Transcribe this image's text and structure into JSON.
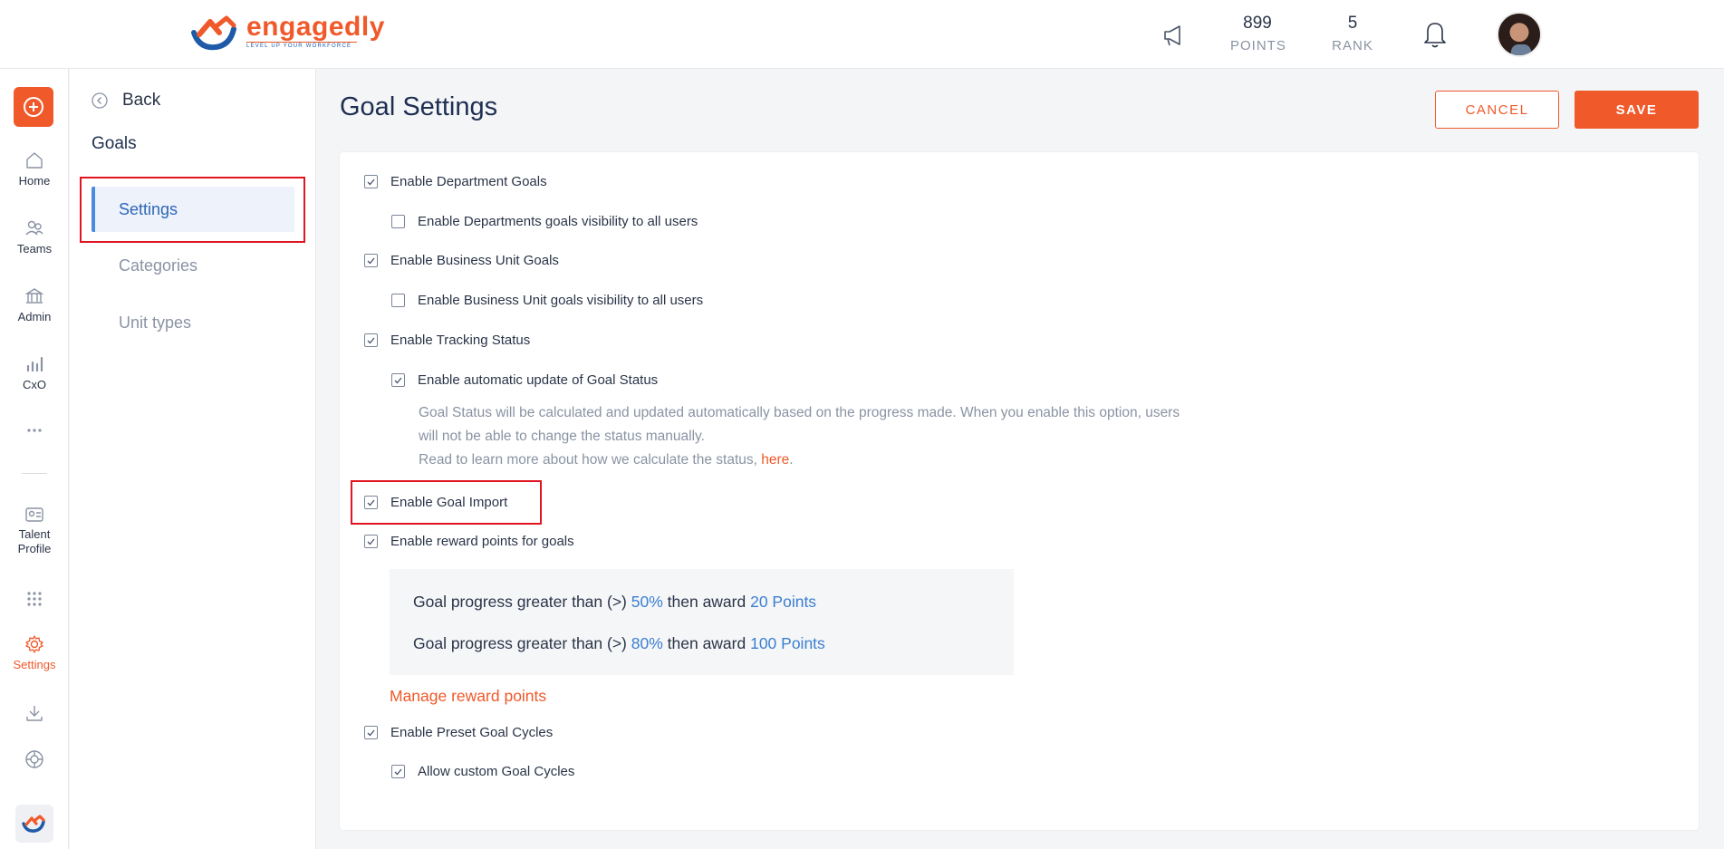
{
  "brand": {
    "name": "engagedly",
    "tagline": "LEVEL UP YOUR WORKFORCE",
    "accent": "#f0592a",
    "blue": "#3b7fd1"
  },
  "header": {
    "points_value": "899",
    "points_label": "POINTS",
    "rank_value": "5",
    "rank_label": "RANK",
    "icons": [
      "megaphone-icon",
      "bell-icon",
      "avatar"
    ]
  },
  "rail": {
    "items": [
      {
        "label": "Home",
        "icon": "home-icon"
      },
      {
        "label": "Teams",
        "icon": "teams-icon"
      },
      {
        "label": "Admin",
        "icon": "admin-icon"
      },
      {
        "label": "CxO",
        "icon": "cxo-icon"
      },
      {
        "label": "",
        "icon": "more-icon"
      },
      {
        "label": "Talent Profile",
        "icon": "talent-profile-icon"
      },
      {
        "label": "",
        "icon": "apps-grid-icon"
      },
      {
        "label": "Settings",
        "icon": "settings-gear-icon"
      },
      {
        "label": "",
        "icon": "download-icon"
      },
      {
        "label": "",
        "icon": "support-icon"
      }
    ]
  },
  "sidebar": {
    "back_label": "Back",
    "section_title": "Goals",
    "items": [
      {
        "label": "Settings",
        "active": true
      },
      {
        "label": "Categories",
        "active": false
      },
      {
        "label": "Unit types",
        "active": false
      }
    ]
  },
  "main": {
    "title": "Goal Settings",
    "cancel_label": "CANCEL",
    "save_label": "SAVE",
    "options": [
      {
        "label": "Enable Department Goals",
        "checked": true
      },
      {
        "label": "Enable Departments goals visibility to all users",
        "checked": false
      },
      {
        "label": "Enable Business Unit Goals",
        "checked": true
      },
      {
        "label": "Enable Business Unit goals visibility to all users",
        "checked": false
      },
      {
        "label": "Enable Tracking Status",
        "checked": true
      },
      {
        "label": "Enable automatic update of Goal Status",
        "checked": true
      },
      {
        "label": "Enable Goal Import",
        "checked": true
      },
      {
        "label": "Enable reward points for goals",
        "checked": true
      },
      {
        "label": "Enable Preset Goal Cycles",
        "checked": true
      },
      {
        "label": "Allow custom Goal Cycles",
        "checked": true
      }
    ],
    "status_description": {
      "line1": "Goal Status will be calculated and updated automatically based on the progress made. When you enable this option, users",
      "line2": "will not be able to change the status manually.",
      "line3_prefix": "Read to learn more about how we calculate the status, ",
      "line3_link": "here",
      "line3_suffix": "."
    },
    "rewards": [
      {
        "prefix": "Goal progress greater than (>) ",
        "percent": "50%",
        "middle": " then award ",
        "points": "20 Points"
      },
      {
        "prefix": "Goal progress greater than (>) ",
        "percent": "80%",
        "middle": " then award ",
        "points": "100 Points"
      }
    ],
    "manage_rewards_label": "Manage reward points"
  }
}
